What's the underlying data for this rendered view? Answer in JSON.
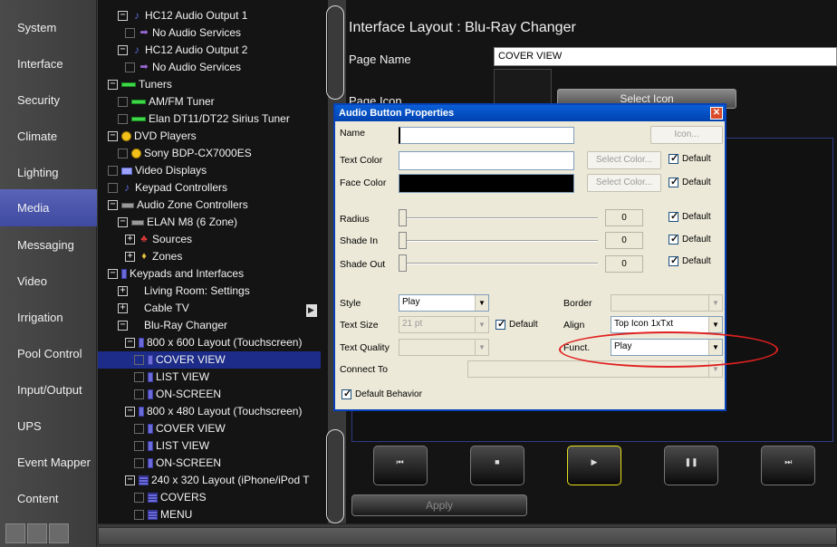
{
  "nav": {
    "items": [
      {
        "label": "System"
      },
      {
        "label": "Interface"
      },
      {
        "label": "Security"
      },
      {
        "label": "Climate"
      },
      {
        "label": "Lighting"
      },
      {
        "label": "Media"
      },
      {
        "label": "Messaging"
      },
      {
        "label": "Video"
      },
      {
        "label": "Irrigation"
      },
      {
        "label": "Pool Control"
      },
      {
        "label": "Input/Output"
      },
      {
        "label": "UPS"
      },
      {
        "label": "Event Mapper"
      },
      {
        "label": "Content"
      }
    ],
    "active": "Media"
  },
  "tree": {
    "rows": [
      {
        "label": "HC12  Audio Output 1"
      },
      {
        "label": "No Audio Services"
      },
      {
        "label": "HC12  Audio Output 2"
      },
      {
        "label": "No Audio Services"
      },
      {
        "label": "Tuners"
      },
      {
        "label": "AM/FM Tuner"
      },
      {
        "label": "Elan DT11/DT22 Sirius Tuner"
      },
      {
        "label": "DVD Players"
      },
      {
        "label": "Sony BDP-CX7000ES"
      },
      {
        "label": "Video Displays"
      },
      {
        "label": "Keypad Controllers"
      },
      {
        "label": "Audio Zone Controllers"
      },
      {
        "label": "ELAN M8 (6 Zone)"
      },
      {
        "label": "Sources"
      },
      {
        "label": "Zones"
      },
      {
        "label": "Keypads and Interfaces"
      },
      {
        "label": "Living Room: Settings"
      },
      {
        "label": "Cable TV"
      },
      {
        "label": "Blu-Ray Changer"
      },
      {
        "label": "800 x 600 Layout (Touchscreen)"
      },
      {
        "label": "COVER VIEW"
      },
      {
        "label": "LIST VIEW"
      },
      {
        "label": "ON-SCREEN"
      },
      {
        "label": "800 x 480 Layout (Touchscreen)"
      },
      {
        "label": "COVER VIEW"
      },
      {
        "label": "LIST VIEW"
      },
      {
        "label": "ON-SCREEN"
      },
      {
        "label": "240 x 320 Layout (iPhone/iPod T"
      },
      {
        "label": "COVERS"
      },
      {
        "label": "MENU"
      }
    ]
  },
  "main": {
    "title": "Interface Layout : Blu-Ray Changer",
    "page_name_label": "Page Name",
    "page_name_value": "COVER VIEW",
    "page_icon_label": "Page Icon",
    "select_icon_label": "Select Icon",
    "apply_label": "Apply"
  },
  "dialog": {
    "title": "Audio Button Properties",
    "close": "✕",
    "name_label": "Name",
    "name_value": "",
    "icon_btn": "Icon...",
    "text_color_label": "Text Color",
    "face_color_label": "Face Color",
    "select_color_btn": "Select Color...",
    "default_label": "Default",
    "radius_label": "Radius",
    "radius_value": "0",
    "shade_in_label": "Shade In",
    "shade_in_value": "0",
    "shade_out_label": "Shade Out",
    "shade_out_value": "0",
    "style_label": "Style",
    "style_value": "Play",
    "border_label": "Border",
    "text_size_label": "Text Size",
    "text_size_value": "21 pt",
    "align_label": "Align",
    "align_value": "Top Icon 1xTxt",
    "text_quality_label": "Text Quality",
    "funct_label": "Funct.",
    "funct_value": "Play",
    "connect_to_label": "Connect To",
    "default_behavior_label": "Default Behavior"
  },
  "colors": {
    "dialog_title": "#0a5fd8",
    "nav_active": "#4a56b0",
    "tree_selection": "#1c2c88",
    "highlight_ellipse": "#e02020"
  },
  "transport": {
    "buttons": [
      {
        "icon": "⏮"
      },
      {
        "icon": "■"
      },
      {
        "icon": "▶"
      },
      {
        "icon": "❚❚"
      },
      {
        "icon": "⏭"
      }
    ]
  }
}
